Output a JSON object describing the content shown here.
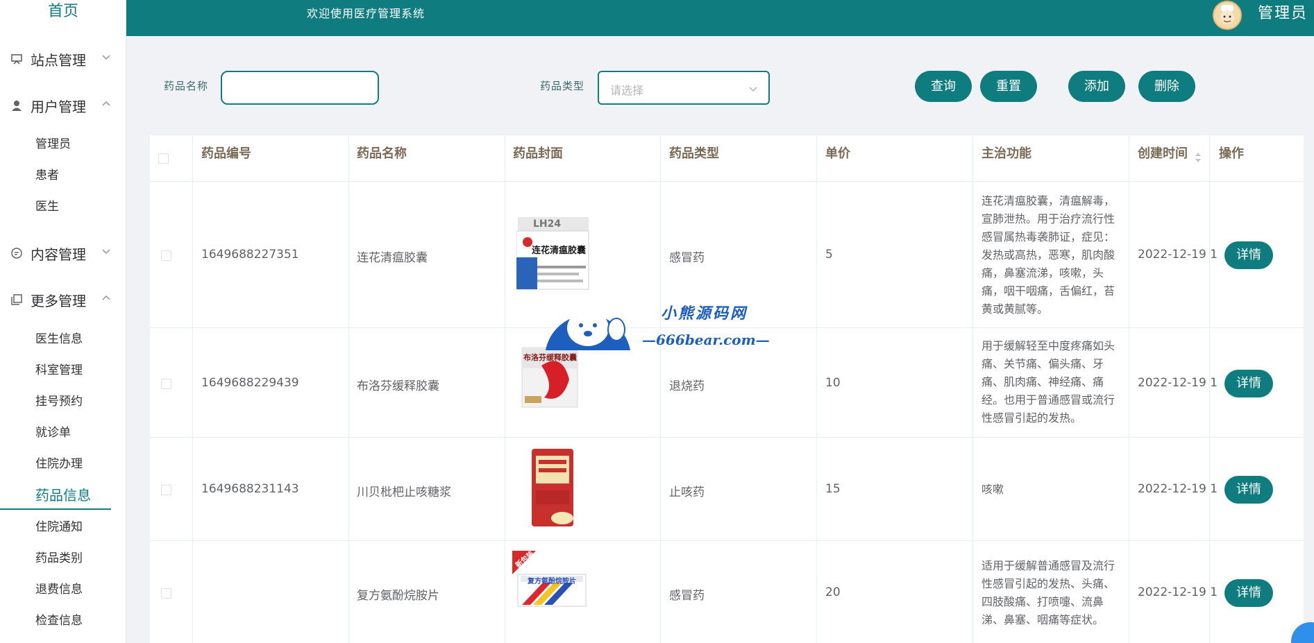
{
  "sidebar": {
    "home_label": "首页",
    "groups": [
      {
        "label": "站点管理",
        "icon": "monitor-icon"
      },
      {
        "label": "用户管理",
        "icon": "user-icon"
      },
      {
        "label": "内容管理",
        "icon": "message-icon"
      },
      {
        "label": "更多管理",
        "icon": "copy-icon"
      }
    ],
    "user_items": [
      "管理员",
      "患者",
      "医生"
    ],
    "more_items": [
      "医生信息",
      "科室管理",
      "挂号预约",
      "就诊单",
      "住院办理",
      "药品信息",
      "住院通知",
      "药品类别",
      "退费信息",
      "检查信息"
    ],
    "active_item": "药品信息"
  },
  "header": {
    "welcome": "欢迎使用医疗管理系统",
    "user_name": "管理员",
    "avatar_icon": "chef-avatar-icon"
  },
  "search": {
    "name_label": "药品名称",
    "name_value": "",
    "type_label": "药品类型",
    "type_placeholder": "请选择",
    "query_button": "查询",
    "reset_button": "重置",
    "add_button": "添加",
    "delete_button": "删除"
  },
  "table": {
    "headers": [
      "药品编号",
      "药品名称",
      "药品封面",
      "药品类型",
      "单价",
      "主治功能",
      "创建时间",
      "操作"
    ],
    "rows": [
      {
        "id": "1649688227351",
        "name": "连花清瘟胶囊",
        "type": "感冒药",
        "price": "5",
        "function": "连花清瘟胶囊，清瘟解毒，宣肺泄热。用于治疗流行性感冒属热毒袭肺证，症见：发热或高热，恶寒，肌肉酸痛，鼻塞流涕，咳嗽，头痛，咽干咽痛，舌偏红，苔黄或黄腻等。",
        "created": "2022-12-19 1",
        "action": "详情",
        "cover_text": "连花清瘟胶囊",
        "cover_top_text": "LH24"
      },
      {
        "id": "1649688229439",
        "name": "布洛芬缓释胶囊",
        "type": "退烧药",
        "price": "10",
        "function": "用于缓解轻至中度疼痛如头痛、关节痛、偏头痛、牙痛、肌肉痛、神经痛、痛经。也用于普通感冒或流行性感冒引起的发热。",
        "created": "2022-12-19 1",
        "action": "详情",
        "cover_text": "布洛芬缓释胶囊"
      },
      {
        "id": "1649688231143",
        "name": "川贝枇杷止咳糖浆",
        "type": "止咳药",
        "price": "15",
        "function": "咳嗽",
        "created": "2022-12-19 1",
        "action": "详情"
      },
      {
        "id": "",
        "name": "复方氨酚烷胺片",
        "type": "感冒药",
        "price": "20",
        "function": "适用于缓解普通感冒及流行性感冒引起的发热、头痛、四肢酸痛、打喷嚏、流鼻涕、鼻塞、咽痛等症状。",
        "created": "2022-12-19 1",
        "action": "详情",
        "cover_text": "复方氨酚烷胺片",
        "cover_badge": "新包装"
      }
    ]
  },
  "watermark": {
    "title": "小熊源码网",
    "url": "—666bear.com—"
  },
  "colors": {
    "primary": "#0f7c80",
    "header_text": "#7a6a55",
    "watermark": "#1d5fbf"
  }
}
